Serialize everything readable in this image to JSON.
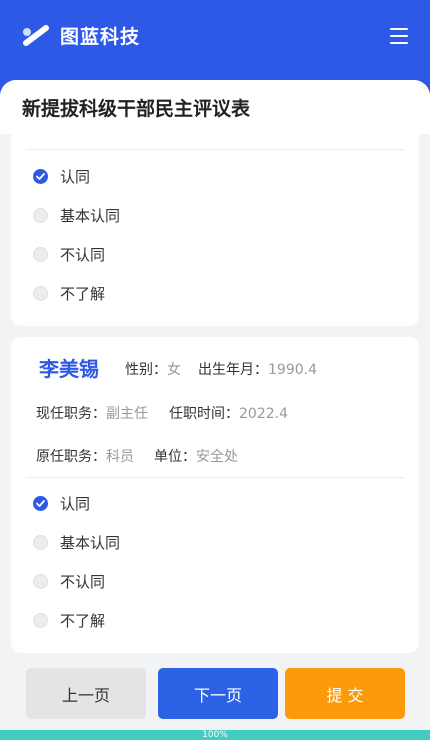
{
  "brand": {
    "name": "图蓝科技",
    "color": "#2e59e6",
    "logo_icon": "brand-logo-icon"
  },
  "header": {
    "menu_icon": "menu-icon"
  },
  "form": {
    "title": "新提拔科级干部民主评议表"
  },
  "card1": {
    "options": [
      {
        "label": "认同",
        "checked": true
      },
      {
        "label": "基本认同",
        "checked": false
      },
      {
        "label": "不认同",
        "checked": false
      },
      {
        "label": "不了解",
        "checked": false
      }
    ]
  },
  "card2": {
    "name": "李美锡",
    "gender_label": "性别：",
    "gender": "女",
    "birth_label": "出生年月：",
    "birth": "1990.4",
    "current_post_label": "现任职务：",
    "current_post": "副主任",
    "appoint_time_label": "任职时间：",
    "appoint_time": "2022.4",
    "former_post_label": "原任职务：",
    "former_post": "科员",
    "unit_label": "单位：",
    "unit": "安全处",
    "options": [
      {
        "label": "认同",
        "checked": true
      },
      {
        "label": "基本认同",
        "checked": false
      },
      {
        "label": "不认同",
        "checked": false
      },
      {
        "label": "不了解",
        "checked": false
      }
    ]
  },
  "buttons": {
    "prev": "上一页",
    "next": "下一页",
    "submit": "提 交"
  },
  "progress": {
    "text": "100%",
    "value": 1.0,
    "color": "#41cbc1"
  },
  "colors": {
    "next_button": "#2c63e6",
    "submit_button": "#fb9b0c",
    "prev_button": "#e4e4e4"
  }
}
